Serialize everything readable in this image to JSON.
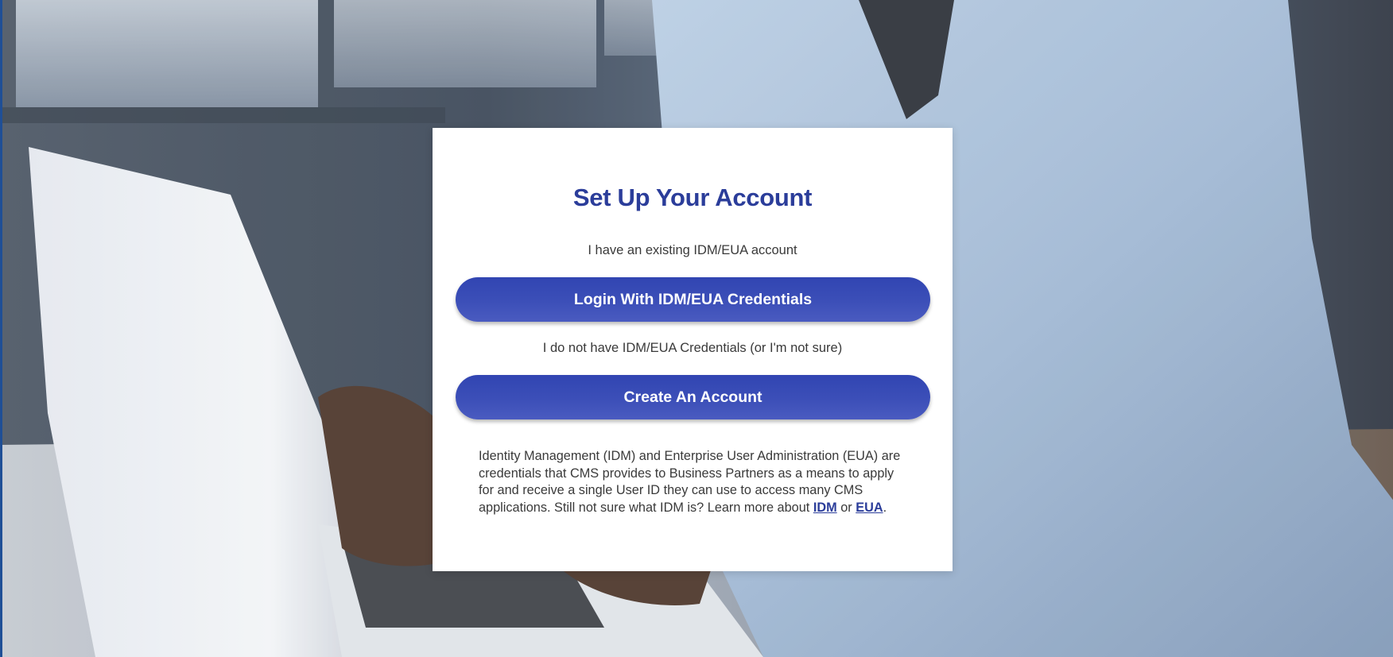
{
  "card": {
    "title": "Set Up Your Account",
    "existing_prompt": "I have an existing IDM/EUA account",
    "login_button": "Login With IDM/EUA Credentials",
    "new_prompt": "I do not have IDM/EUA Credentials (or I'm not sure)",
    "create_button": "Create An Account",
    "info_text": "Identity Management (IDM) and Enterprise User Administration (EUA) are credentials that CMS provides to Business Partners as a means to apply for and receive a single User ID they can use to access many CMS applications. Still not sure what IDM is? Learn more about",
    "info_link_idm": "IDM",
    "info_or": "or",
    "info_link_eua": "EUA",
    "info_period": "."
  },
  "colors": {
    "accent": "#2b3d9a",
    "button": "#3c4fb8",
    "card_bg": "#ffffff",
    "text": "#3a3a3a"
  }
}
